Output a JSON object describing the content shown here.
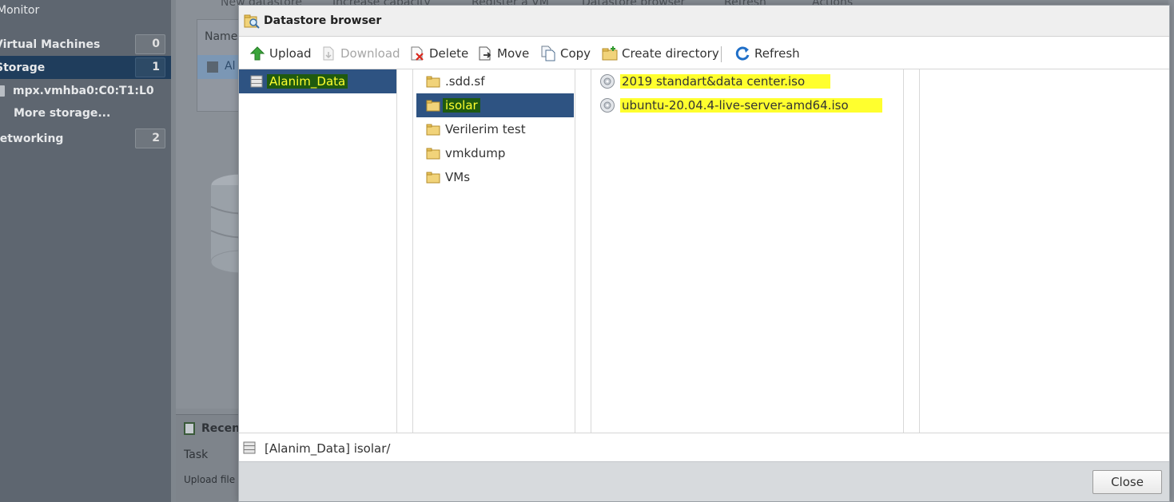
{
  "background": {
    "sidebar": {
      "items": [
        {
          "label": "Monitor",
          "count": ""
        },
        {
          "label": "Virtual Machines",
          "count": "0"
        },
        {
          "label": "Storage",
          "count": "1"
        },
        {
          "label": "mpx.vmhba0:C0:T1:L0",
          "count": ""
        },
        {
          "label": "More storage...",
          "count": ""
        },
        {
          "label": "Networking",
          "count": "2"
        }
      ]
    },
    "toolbar": {
      "new_datastore": "New datastore",
      "increase_capacity": "Increase capacity",
      "register_vm": "Register a VM",
      "datastore_browser": "Datastore browser",
      "refresh": "Refresh",
      "actions": "Actions"
    },
    "grid": {
      "header": "Name",
      "row": "Al"
    },
    "recent": {
      "title": "Recen",
      "task_header": "Task",
      "row1": "Upload file t"
    }
  },
  "dialog": {
    "title": "Datastore browser",
    "toolbar": {
      "upload": "Upload",
      "download": "Download",
      "delete": "Delete",
      "move": "Move",
      "copy": "Copy",
      "create_directory": "Create directory",
      "refresh": "Refresh"
    },
    "datastores": [
      {
        "name": "Alanim_Data",
        "selected": true
      }
    ],
    "folders": [
      {
        "name": ".sdd.sf",
        "selected": false
      },
      {
        "name": "isolar",
        "selected": true
      },
      {
        "name": "Verilerim test",
        "selected": false
      },
      {
        "name": "vmkdump",
        "selected": false
      },
      {
        "name": "VMs",
        "selected": false
      }
    ],
    "files": [
      {
        "name": "2019 standart&data center.iso"
      },
      {
        "name": "ubuntu-20.04.4-live-server-amd64.iso"
      }
    ],
    "status_path": "[Alanim_Data] isolar/",
    "close_label": "Close"
  }
}
